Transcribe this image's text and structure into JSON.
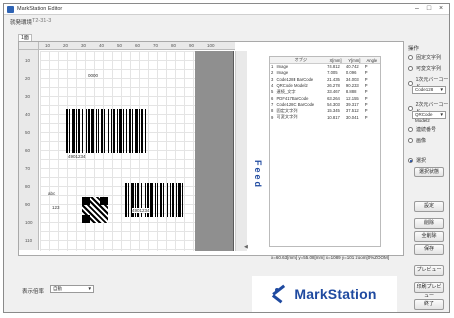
{
  "window": {
    "title": "MarkStation Editor"
  },
  "printer": {
    "label": "就発環境",
    "value": "T2-31-3"
  },
  "tab": {
    "label": "1面"
  },
  "ruler": {
    "h_ticks": [
      "10",
      "20",
      "30",
      "40",
      "50",
      "60",
      "70",
      "80",
      "90",
      "100"
    ],
    "v_ticks": [
      "10",
      "20",
      "30",
      "40",
      "50",
      "60",
      "70",
      "80",
      "90",
      "100",
      "110"
    ]
  },
  "label_objects": {
    "text_top": "0000",
    "barcode1_text": "4901234",
    "barcode2_text": "4901234",
    "small_text": "abc",
    "qr_text": "123"
  },
  "feed_label": "Feed",
  "table": {
    "headers": [
      "",
      "オブジ",
      "X[mm]",
      "Y[mm]",
      "Angle"
    ],
    "rows": [
      [
        "1",
        "Image",
        "74.812",
        "40.742",
        "P"
      ],
      [
        "2",
        "Image",
        "7.005",
        "0.096",
        "P"
      ],
      [
        "3",
        "Code128Ⅱ BarCode",
        "21.435",
        "34.003",
        "P"
      ],
      [
        "4",
        "QRCode Model2",
        "26.278",
        "90.233",
        "P"
      ],
      [
        "5",
        "連続_文字",
        "33.467",
        "8.888",
        "P"
      ],
      [
        "6",
        "PDF417BarCode",
        "63.264",
        "12.155",
        "P"
      ],
      [
        "7",
        "Code128C BarCode",
        "54.303",
        "39.317",
        "P"
      ],
      [
        "8",
        "固定文字列",
        "15.345",
        "37.512",
        "P"
      ],
      [
        "9",
        "可変文字列",
        "10.817",
        "30.041",
        "P"
      ]
    ]
  },
  "coords": "x=60.63[mm] y=55.08[mm]  x=1089 y=101  zoom[0%ZOOM]",
  "ops": {
    "title": "操作",
    "radios": [
      {
        "label": "固定文字列",
        "checked": false
      },
      {
        "label": "可変文字列",
        "checked": false
      },
      {
        "label": "1次元バーコード",
        "checked": false
      },
      {
        "label": "2次元バーコード",
        "checked": false
      },
      {
        "label": "連続番号",
        "checked": false
      },
      {
        "label": "画像",
        "checked": false
      },
      {
        "label": "選択",
        "checked": true
      }
    ],
    "select_1d": "Code128",
    "select_2d": "QRCode Model2",
    "buttons": [
      "選択状態",
      "設定",
      "削除",
      "全削除",
      "保存",
      "プレビュー",
      "印刷プレビュー",
      "終了"
    ]
  },
  "footer": {
    "label": "表示倍率",
    "zoom_value": "自動"
  },
  "logo": {
    "name": "MarkStation"
  }
}
